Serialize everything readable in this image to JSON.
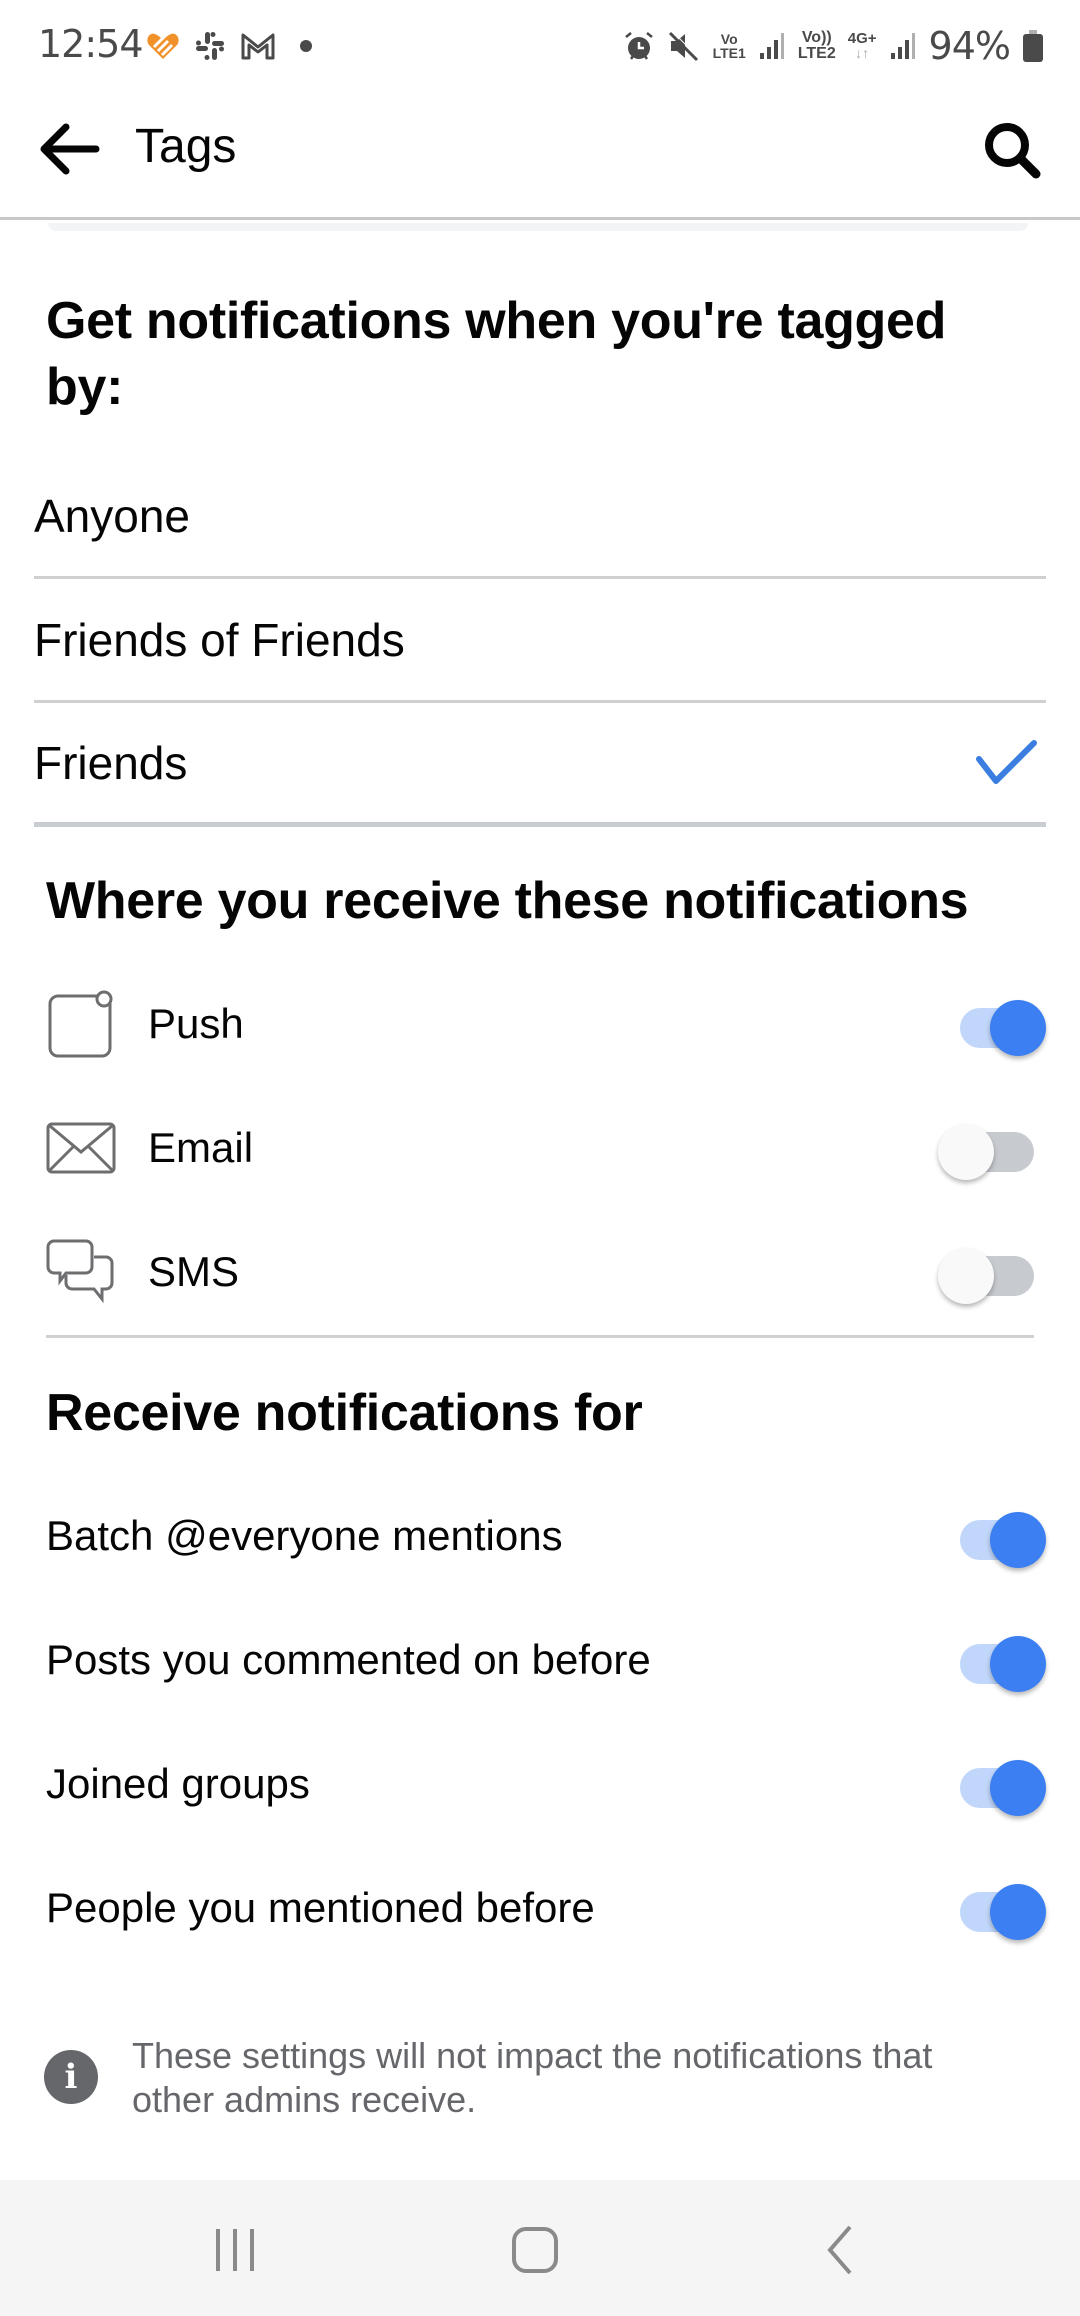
{
  "status_bar": {
    "time": "12:54",
    "left_icons": [
      "health-heart-icon",
      "slack-icon",
      "gmail-icon",
      "dot-icon"
    ],
    "right_icons": [
      "alarm-icon",
      "mute-icon",
      "volte1-icon",
      "signal1-icon",
      "volte2-icon",
      "4g-plus-icon",
      "signal2-icon",
      "battery-icon"
    ],
    "volte1_top": "Vo",
    "volte1_bottom": "LTE1",
    "volte2_top": "Vo))",
    "volte2_bottom": "LTE2",
    "network_type": "4G+",
    "battery_percent": "94%"
  },
  "app_bar": {
    "title": "Tags",
    "back_icon": "arrow-left-icon",
    "search_icon": "search-icon"
  },
  "tagged_by": {
    "title": "Get notifications when you're tagged by:",
    "options": [
      {
        "label": "Anyone",
        "selected": false
      },
      {
        "label": "Friends of Friends",
        "selected": false
      },
      {
        "label": "Friends",
        "selected": true
      }
    ]
  },
  "channels": {
    "title": "Where you receive these notifications",
    "items": [
      {
        "label": "Push",
        "icon": "push-notification-icon",
        "enabled": true
      },
      {
        "label": "Email",
        "icon": "envelope-icon",
        "enabled": false
      },
      {
        "label": "SMS",
        "icon": "chat-bubbles-icon",
        "enabled": false
      }
    ]
  },
  "receive_for": {
    "title": "Receive notifications for",
    "items": [
      {
        "label": "Batch @everyone mentions",
        "enabled": true
      },
      {
        "label": "Posts you commented on before",
        "enabled": true
      },
      {
        "label": "Joined groups",
        "enabled": true
      },
      {
        "label": "People you mentioned before",
        "enabled": true
      }
    ]
  },
  "info": {
    "icon": "info-icon",
    "text": "These settings will not impact the notifications that other admins receive."
  },
  "nav_bar": {
    "recents_icon": "recents-icon",
    "home_icon": "home-icon",
    "back_icon": "back-chevron-icon"
  },
  "colors": {
    "accent": "#3b7ff3",
    "toggle_track_on": "#c0d6fa",
    "toggle_track_off": "#c7cacf",
    "check": "#3b7de0",
    "secondary_text": "#65676b"
  }
}
